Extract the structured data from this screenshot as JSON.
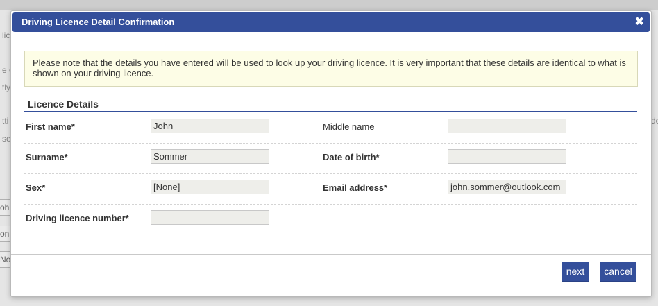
{
  "background": {
    "fragments": [
      "lic",
      "e c",
      "tly",
      "tti",
      "ser",
      "de"
    ],
    "inputs": [
      "oh",
      "on",
      "No"
    ]
  },
  "dialog": {
    "title": "Driving Licence Detail Confirmation",
    "close_icon": "✖",
    "notice": "Please note that the details you have entered will be used to look up your driving licence. It is very important that these details are identical to what is shown on your driving licence.",
    "section_title": "Licence Details",
    "fields": {
      "first_name": {
        "label": "First name*",
        "value": "John"
      },
      "middle_name": {
        "label": "Middle name",
        "value": ""
      },
      "surname": {
        "label": "Surname*",
        "value": "Sommer"
      },
      "date_of_birth": {
        "label": "Date of birth*",
        "value": ""
      },
      "sex": {
        "label": "Sex*",
        "value": "[None]"
      },
      "email": {
        "label": "Email address*",
        "value": "john.sommer@outlook.com"
      },
      "licence_number": {
        "label": "Driving licence number*",
        "value": ""
      }
    },
    "buttons": {
      "next": "next",
      "cancel": "cancel"
    }
  },
  "colors": {
    "accent": "#344f9b",
    "notice_bg": "#fdfde6"
  }
}
